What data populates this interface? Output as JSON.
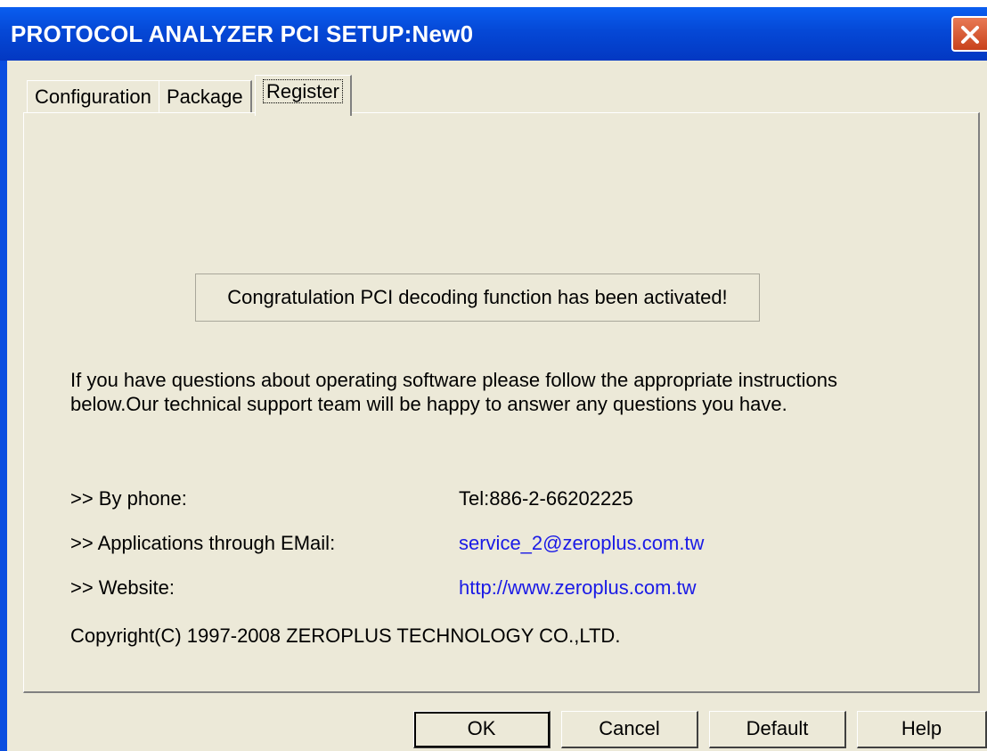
{
  "window": {
    "title": "PROTOCOL ANALYZER PCI SETUP:New0"
  },
  "tabs": [
    {
      "label": "Configuration"
    },
    {
      "label": "Package"
    },
    {
      "label": "Register"
    }
  ],
  "register": {
    "message": "Congratulation PCI decoding function has been activated!",
    "info_line1": "If you have questions about operating software please follow the appropriate instructions",
    "info_line2": "below.Our technical support team will be happy to answer any questions you have.",
    "phone_label": ">> By phone:",
    "phone_value": "Tel:886-2-66202225",
    "email_label": ">> Applications through EMail:",
    "email_value": "service_2@zeroplus.com.tw",
    "website_label": ">> Website:",
    "website_value": "http://www.zeroplus.com.tw",
    "copyright": "Copyright(C) 1997-2008 ZEROPLUS TECHNOLOGY CO.,LTD."
  },
  "buttons": {
    "ok": "OK",
    "cancel": "Cancel",
    "default": "Default",
    "help": "Help"
  },
  "colors": {
    "titlebar": "#0548d6",
    "dialog_bg": "#ece9d8",
    "link": "#1a1ae6",
    "close_button": "#d85a30"
  },
  "icons": {
    "close": "close-icon"
  }
}
